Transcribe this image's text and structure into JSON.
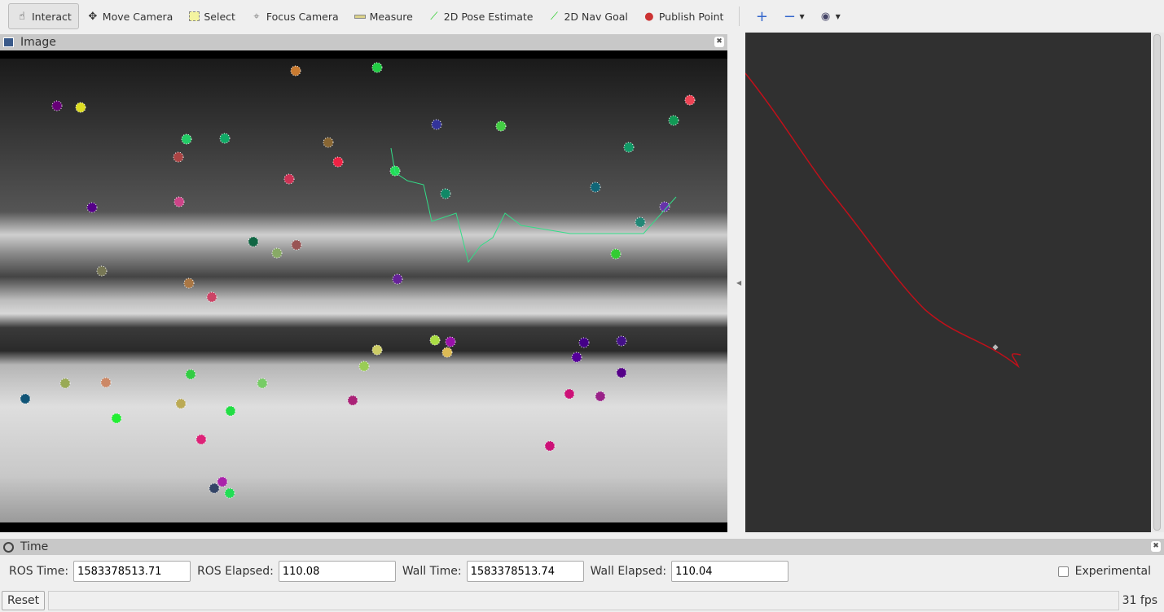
{
  "toolbar": {
    "tools": [
      {
        "label": "Interact",
        "icon": "hand-icon",
        "active": true
      },
      {
        "label": "Move Camera",
        "icon": "move-camera-icon"
      },
      {
        "label": "Select",
        "icon": "select-box-icon"
      },
      {
        "label": "Focus Camera",
        "icon": "focus-camera-icon"
      },
      {
        "label": "Measure",
        "icon": "ruler-icon"
      },
      {
        "label": "2D Pose Estimate",
        "icon": "green-arrow-icon"
      },
      {
        "label": "2D Nav Goal",
        "icon": "green-arrow-icon"
      },
      {
        "label": "Publish Point",
        "icon": "map-pin-icon"
      }
    ]
  },
  "image_panel": {
    "title": "Image"
  },
  "time_panel": {
    "title": "Time",
    "ros_time_label": "ROS Time:",
    "ros_time": "1583378513.71",
    "ros_elapsed_label": "ROS Elapsed:",
    "ros_elapsed": "110.08",
    "wall_time_label": "Wall Time:",
    "wall_time": "1583378513.74",
    "wall_elapsed_label": "Wall Elapsed:",
    "wall_elapsed": "110.04",
    "experimental_label": "Experimental",
    "experimental": false
  },
  "status": {
    "reset_label": "Reset",
    "fps": "31 fps"
  },
  "colors": {
    "trajectory": "#c0101a",
    "view_bg": "#303030"
  }
}
